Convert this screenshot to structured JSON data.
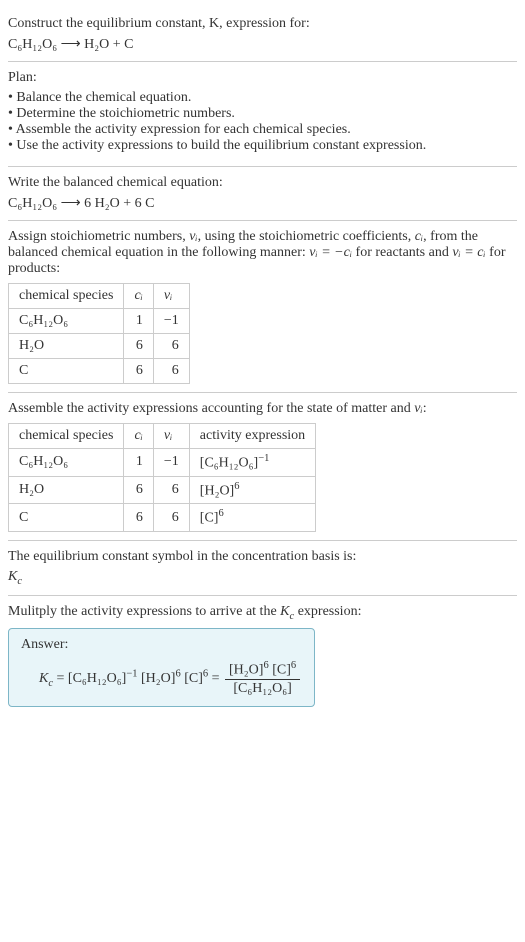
{
  "intro": {
    "line1": "Construct the equilibrium constant, K, expression for:",
    "eq_lhs": "C₆H₁₂O₆",
    "eq_arrow": "⟶",
    "eq_rhs": "H₂O + C"
  },
  "plan": {
    "title": "Plan:",
    "items": [
      "Balance the chemical equation.",
      "Determine the stoichiometric numbers.",
      "Assemble the activity expression for each chemical species.",
      "Use the activity expressions to build the equilibrium constant expression."
    ]
  },
  "balanced": {
    "title": "Write the balanced chemical equation:",
    "eq_lhs": "C₆H₁₂O₆",
    "eq_arrow": "⟶",
    "eq_rhs": "6 H₂O + 6 C"
  },
  "assign": {
    "text_a": "Assign stoichiometric numbers, ",
    "nu_i": "νᵢ",
    "text_b": ", using the stoichiometric coefficients, ",
    "c_i": "cᵢ",
    "text_c": ", from the balanced chemical equation in the following manner: ",
    "rule_reactants": "νᵢ = −cᵢ",
    "text_d": " for reactants and ",
    "rule_products": "νᵢ = cᵢ",
    "text_e": " for products:",
    "headers": {
      "species": "chemical species",
      "c": "cᵢ",
      "nu": "νᵢ"
    },
    "rows": [
      {
        "species": "C₆H₁₂O₆",
        "c": "1",
        "nu": "−1"
      },
      {
        "species": "H₂O",
        "c": "6",
        "nu": "6"
      },
      {
        "species": "C",
        "c": "6",
        "nu": "6"
      }
    ]
  },
  "activity": {
    "text_a": "Assemble the activity expressions accounting for the state of matter and ",
    "nu_i": "νᵢ",
    "text_b": ":",
    "headers": {
      "species": "chemical species",
      "c": "cᵢ",
      "nu": "νᵢ",
      "act": "activity expression"
    },
    "rows": [
      {
        "species": "C₆H₁₂O₆",
        "c": "1",
        "nu": "−1",
        "act_base": "[C₆H₁₂O₆]",
        "act_exp": "−1"
      },
      {
        "species": "H₂O",
        "c": "6",
        "nu": "6",
        "act_base": "[H₂O]",
        "act_exp": "6"
      },
      {
        "species": "C",
        "c": "6",
        "nu": "6",
        "act_base": "[C]",
        "act_exp": "6"
      }
    ]
  },
  "symbol": {
    "text": "The equilibrium constant symbol in the concentration basis is:",
    "K_base": "K",
    "K_sub": "c"
  },
  "multiply": {
    "text_a": "Mulitply the activity expressions to arrive at the ",
    "K_base": "K",
    "K_sub": "c",
    "text_b": " expression:"
  },
  "answer": {
    "label": "Answer:",
    "Kc_base": "K",
    "Kc_sub": "c",
    "term1_base": "[C₆H₁₂O₆]",
    "term1_exp": "−1",
    "term2_base": "[H₂O]",
    "term2_exp": "6",
    "term3_base": "[C]",
    "term3_exp": "6",
    "frac_num_a_base": "[H₂O]",
    "frac_num_a_exp": "6",
    "frac_num_b_base": "[C]",
    "frac_num_b_exp": "6",
    "frac_den": "[C₆H₁₂O₆]"
  }
}
